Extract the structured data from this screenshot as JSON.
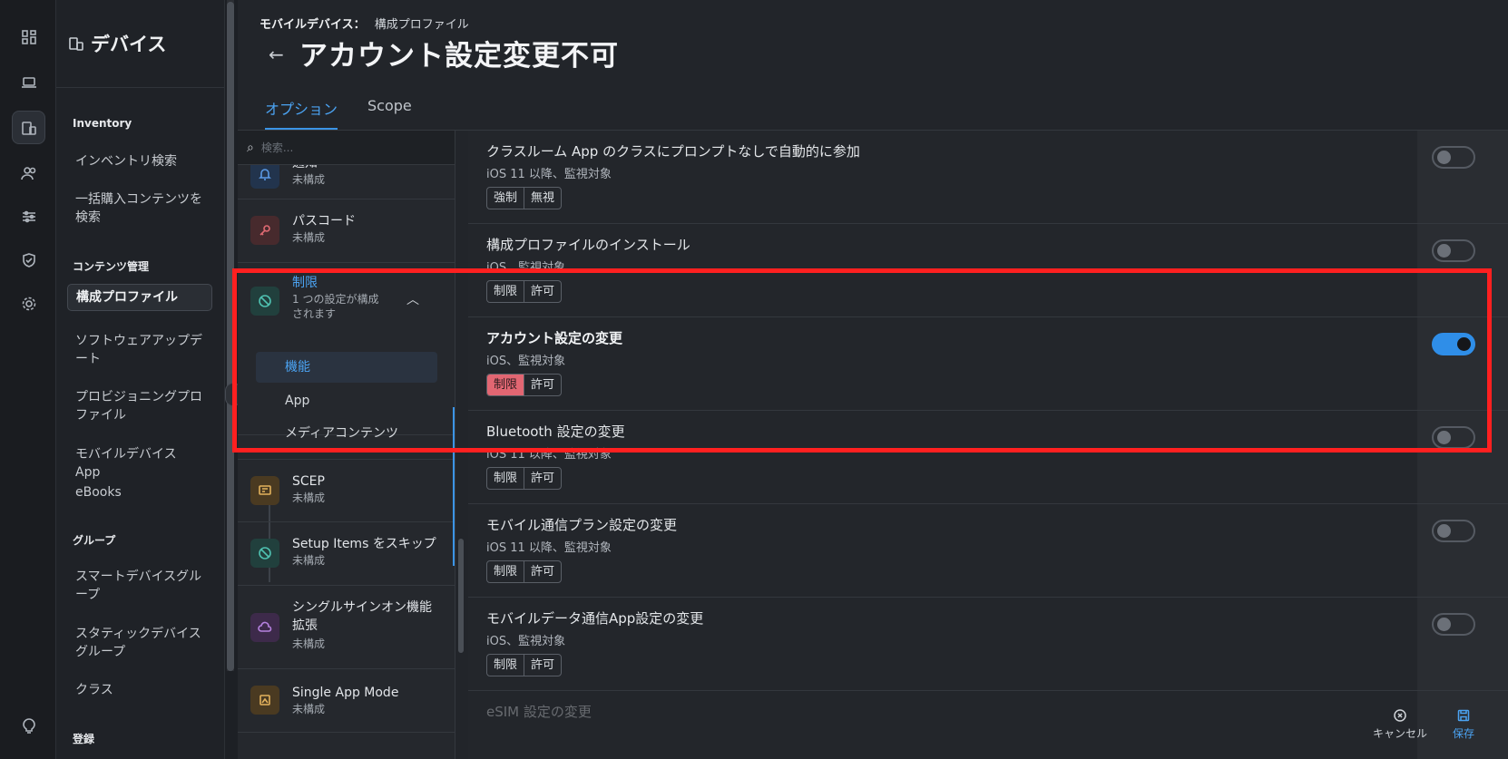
{
  "nav": {
    "title": "デバイス",
    "sections": {
      "inventory": "Inventory",
      "content": "コンテンツ管理",
      "groups": "グループ",
      "enroll": "登録"
    },
    "items": {
      "inventory_search": "インベントリ検索",
      "bulk_search": "一括購入コンテンツを検索",
      "config_profiles": "構成プロファイル",
      "software_update": "ソフトウェアアップデート",
      "provisioning": "プロビジョニングプロファイル",
      "mobile_apps": "モバイルデバイス App",
      "ebooks": "eBooks",
      "smart_groups": "スマートデバイスグループ",
      "static_groups": "スタティックデバイスグループ",
      "classes": "クラス"
    }
  },
  "header": {
    "breadcrumb_parent": "モバイルデバイス：",
    "breadcrumb_current": "構成プロファイル",
    "title": "アカウント設定変更不可"
  },
  "tabs": {
    "options": "オプション",
    "scope": "Scope"
  },
  "search": {
    "placeholder": "検索..."
  },
  "payloads": {
    "notifications": {
      "name": "通知",
      "status": "未構成"
    },
    "passcode": {
      "name": "パスコード",
      "status": "未構成"
    },
    "restrictions": {
      "name": "制限",
      "status": "1 つの設定が構成されます"
    },
    "sub": {
      "functionality": "機能",
      "app": "App",
      "media": "メディアコンテンツ"
    },
    "scep": {
      "name": "SCEP",
      "status": "未構成"
    },
    "skip_setup": {
      "name": "Setup Items をスキップ",
      "status": "未構成"
    },
    "sso": {
      "name": "シングルサインオン機能拡張",
      "status": "未構成"
    },
    "single_app": {
      "name": "Single App Mode",
      "status": "未構成"
    }
  },
  "settings": [
    {
      "title": "クラスルーム App のクラスにプロンプトなしで自動的に参加",
      "sub": "iOS 11 以降、監視対象",
      "opt_a": "強制",
      "opt_b": "無視",
      "selected": null,
      "enabled": false
    },
    {
      "title": "構成プロファイルのインストール",
      "sub": "iOS、監視対象",
      "opt_a": "制限",
      "opt_b": "許可",
      "selected": null,
      "enabled": false
    },
    {
      "title": "アカウント設定の変更",
      "sub": "iOS、監視対象",
      "opt_a": "制限",
      "opt_b": "許可",
      "selected": "制限",
      "enabled": true
    },
    {
      "title": "Bluetooth 設定の変更",
      "sub": "iOS 11 以降、監視対象",
      "opt_a": "制限",
      "opt_b": "許可",
      "selected": null,
      "enabled": false
    },
    {
      "title": "モバイル通信プラン設定の変更",
      "sub": "iOS 11 以降、監視対象",
      "opt_a": "制限",
      "opt_b": "許可",
      "selected": null,
      "enabled": false
    },
    {
      "title": "モバイルデータ通信App設定の変更",
      "sub": "iOS、監視対象",
      "opt_a": "制限",
      "opt_b": "許可",
      "selected": null,
      "enabled": false
    },
    {
      "title": "eSIM 設定の変更"
    }
  ],
  "footer": {
    "cancel": "キャンセル",
    "save": "保存"
  },
  "colors": {
    "accent": "#3b94e6",
    "restrict_selected": "#e26672",
    "highlight": "#ff2020"
  }
}
